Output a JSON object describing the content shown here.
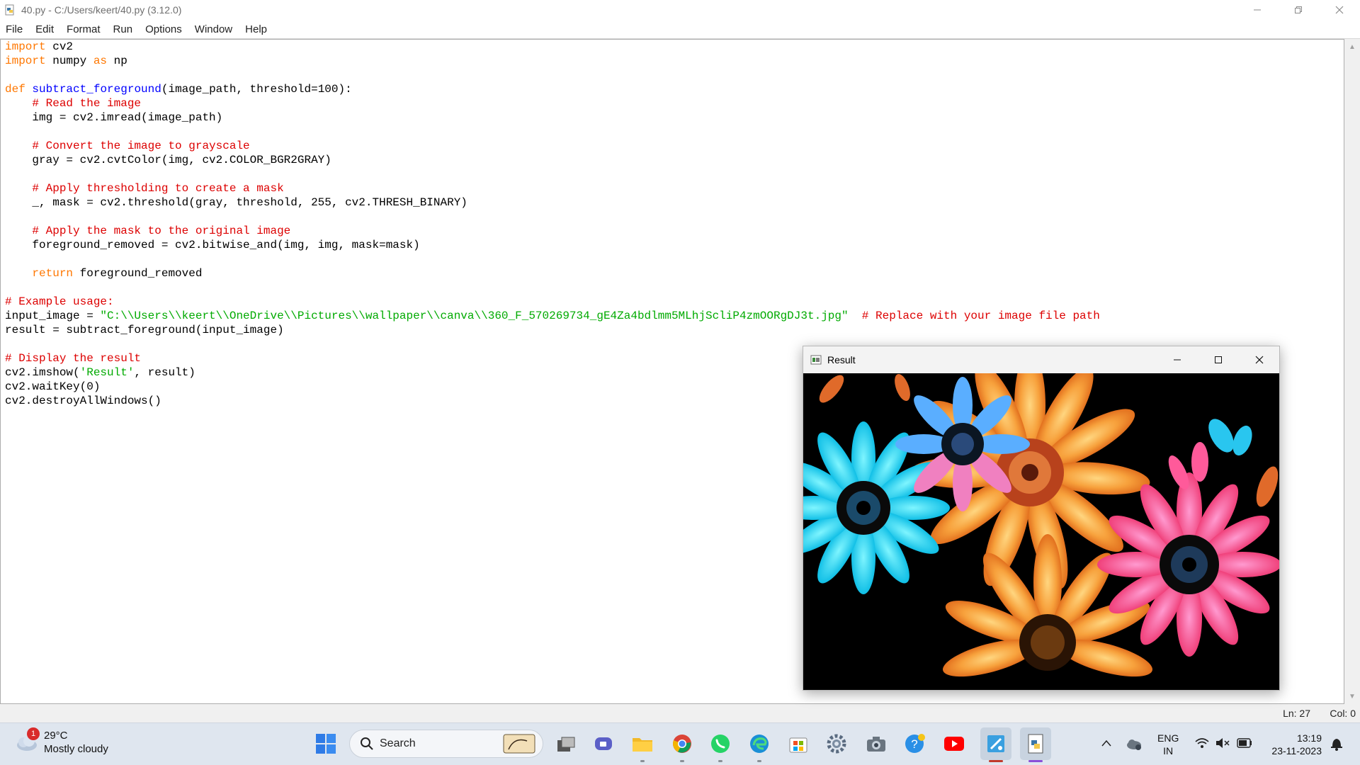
{
  "window": {
    "title": "40.py - C:/Users/keert/40.py (3.12.0)"
  },
  "menu": [
    "File",
    "Edit",
    "Format",
    "Run",
    "Options",
    "Window",
    "Help"
  ],
  "editor": {
    "lines": [
      [
        [
          "kw",
          "import"
        ],
        [
          "n",
          " cv2"
        ]
      ],
      [
        [
          "kw",
          "import"
        ],
        [
          "n",
          " numpy "
        ],
        [
          "kw",
          "as"
        ],
        [
          "n",
          " np"
        ]
      ],
      [],
      [
        [
          "kw",
          "def"
        ],
        [
          "n",
          " "
        ],
        [
          "fn",
          "subtract_foreground"
        ],
        [
          "n",
          "(image_path, threshold=100):"
        ]
      ],
      [
        [
          "n",
          "    "
        ],
        [
          "cm",
          "# Read the image"
        ]
      ],
      [
        [
          "n",
          "    img = cv2.imread(image_path)"
        ]
      ],
      [],
      [
        [
          "n",
          "    "
        ],
        [
          "cm",
          "# Convert the image to grayscale"
        ]
      ],
      [
        [
          "n",
          "    gray = cv2.cvtColor(img, cv2.COLOR_BGR2GRAY)"
        ]
      ],
      [],
      [
        [
          "n",
          "    "
        ],
        [
          "cm",
          "# Apply thresholding to create a mask"
        ]
      ],
      [
        [
          "n",
          "    _, mask = cv2.threshold(gray, threshold, 255, cv2.THRESH_BINARY)"
        ]
      ],
      [],
      [
        [
          "n",
          "    "
        ],
        [
          "cm",
          "# Apply the mask to the original image"
        ]
      ],
      [
        [
          "n",
          "    foreground_removed = cv2.bitwise_and(img, img, mask=mask)"
        ]
      ],
      [],
      [
        [
          "n",
          "    "
        ],
        [
          "kw",
          "return"
        ],
        [
          "n",
          " foreground_removed"
        ]
      ],
      [],
      [
        [
          "cm",
          "# Example usage:"
        ]
      ],
      [
        [
          "n",
          "input_image = "
        ],
        [
          "st",
          "\"C:\\\\Users\\\\keert\\\\OneDrive\\\\Pictures\\\\wallpaper\\\\canva\\\\360_F_570269734_gE4Za4bdlmm5MLhjScliP4zmOORgDJ3t.jpg\""
        ],
        [
          "n",
          "  "
        ],
        [
          "cm",
          "# Replace with your image file path"
        ]
      ],
      [
        [
          "n",
          "result = subtract_foreground(input_image)"
        ]
      ],
      [],
      [
        [
          "cm",
          "# Display the result"
        ]
      ],
      [
        [
          "n",
          "cv2.imshow("
        ],
        [
          "st",
          "'Result'"
        ],
        [
          "n",
          ", result)"
        ]
      ],
      [
        [
          "n",
          "cv2.waitKey(0)"
        ]
      ],
      [
        [
          "n",
          "cv2.destroyAllWindows()"
        ]
      ]
    ]
  },
  "status": {
    "line": "Ln: 27",
    "col": "Col: 0"
  },
  "result_window": {
    "title": "Result"
  },
  "taskbar": {
    "weather_temp": "29°C",
    "weather_desc": "Mostly cloudy",
    "notification_count": "1",
    "search_label": "Search",
    "language": "ENG",
    "region": "IN",
    "time": "13:19",
    "date": "23-11-2023"
  }
}
